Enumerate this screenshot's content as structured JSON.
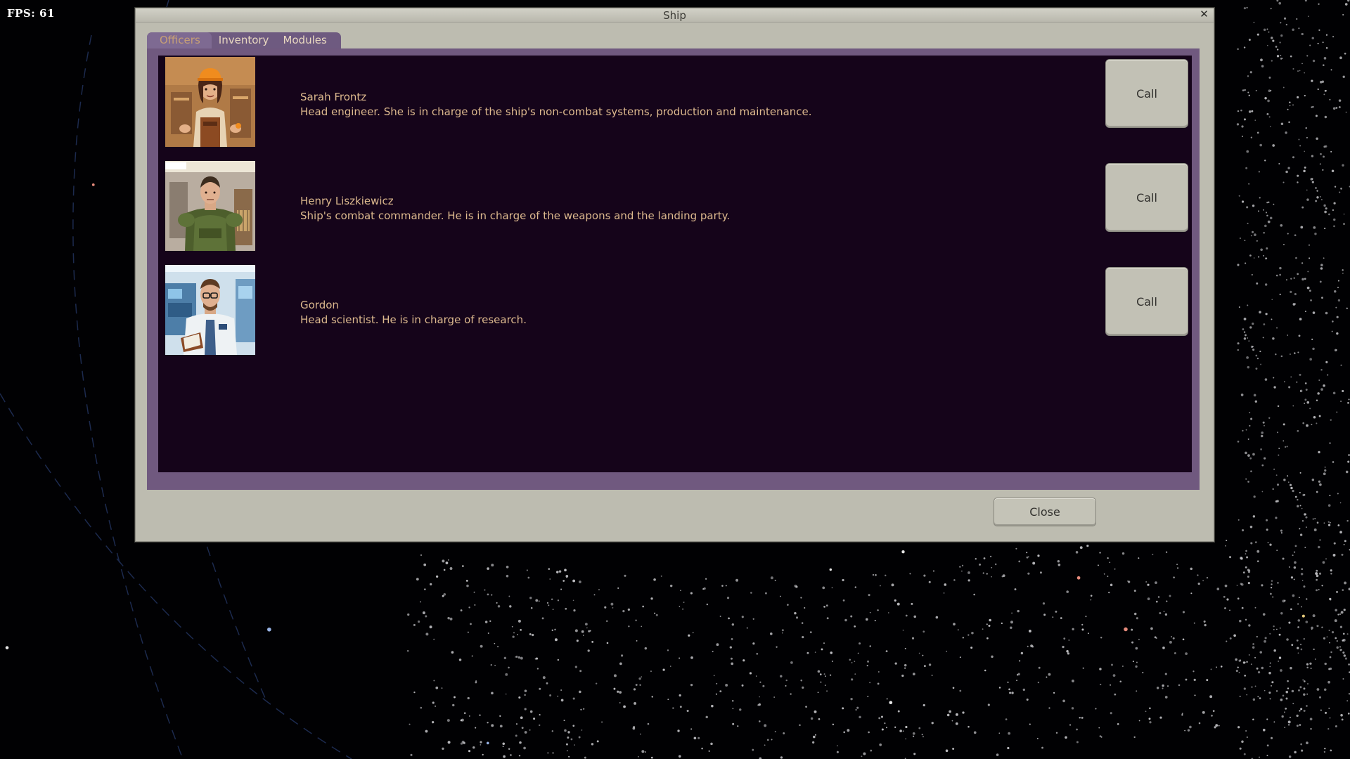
{
  "hud": {
    "fps_text": "FPS: 61"
  },
  "window": {
    "title": "Ship",
    "close_icon": "close-icon",
    "tabs": [
      {
        "label": "Officers",
        "active": true
      },
      {
        "label": "Inventory",
        "active": false
      },
      {
        "label": "Modules",
        "active": false
      }
    ],
    "officers": [
      {
        "name": "Sarah Frontz",
        "description": "Head engineer. She is in charge of the ship's non-combat systems, production and maintenance.",
        "call_label": "Call",
        "portrait": "engineer-portrait"
      },
      {
        "name": "Henry Liszkiewicz",
        "description": "Ship's combat commander. He is in charge of the weapons and the landing party.",
        "call_label": "Call",
        "portrait": "commander-portrait"
      },
      {
        "name": "Gordon",
        "description": "Head scientist. He is in charge of research.",
        "call_label": "Call",
        "portrait": "scientist-portrait"
      }
    ],
    "close_label": "Close"
  },
  "colors": {
    "window_bg": "#bdbcb0",
    "panel_frame": "#70597f",
    "panel_bg": "#15041a",
    "officer_text": "#ddb98e",
    "active_tab_text": "#c79f76"
  }
}
